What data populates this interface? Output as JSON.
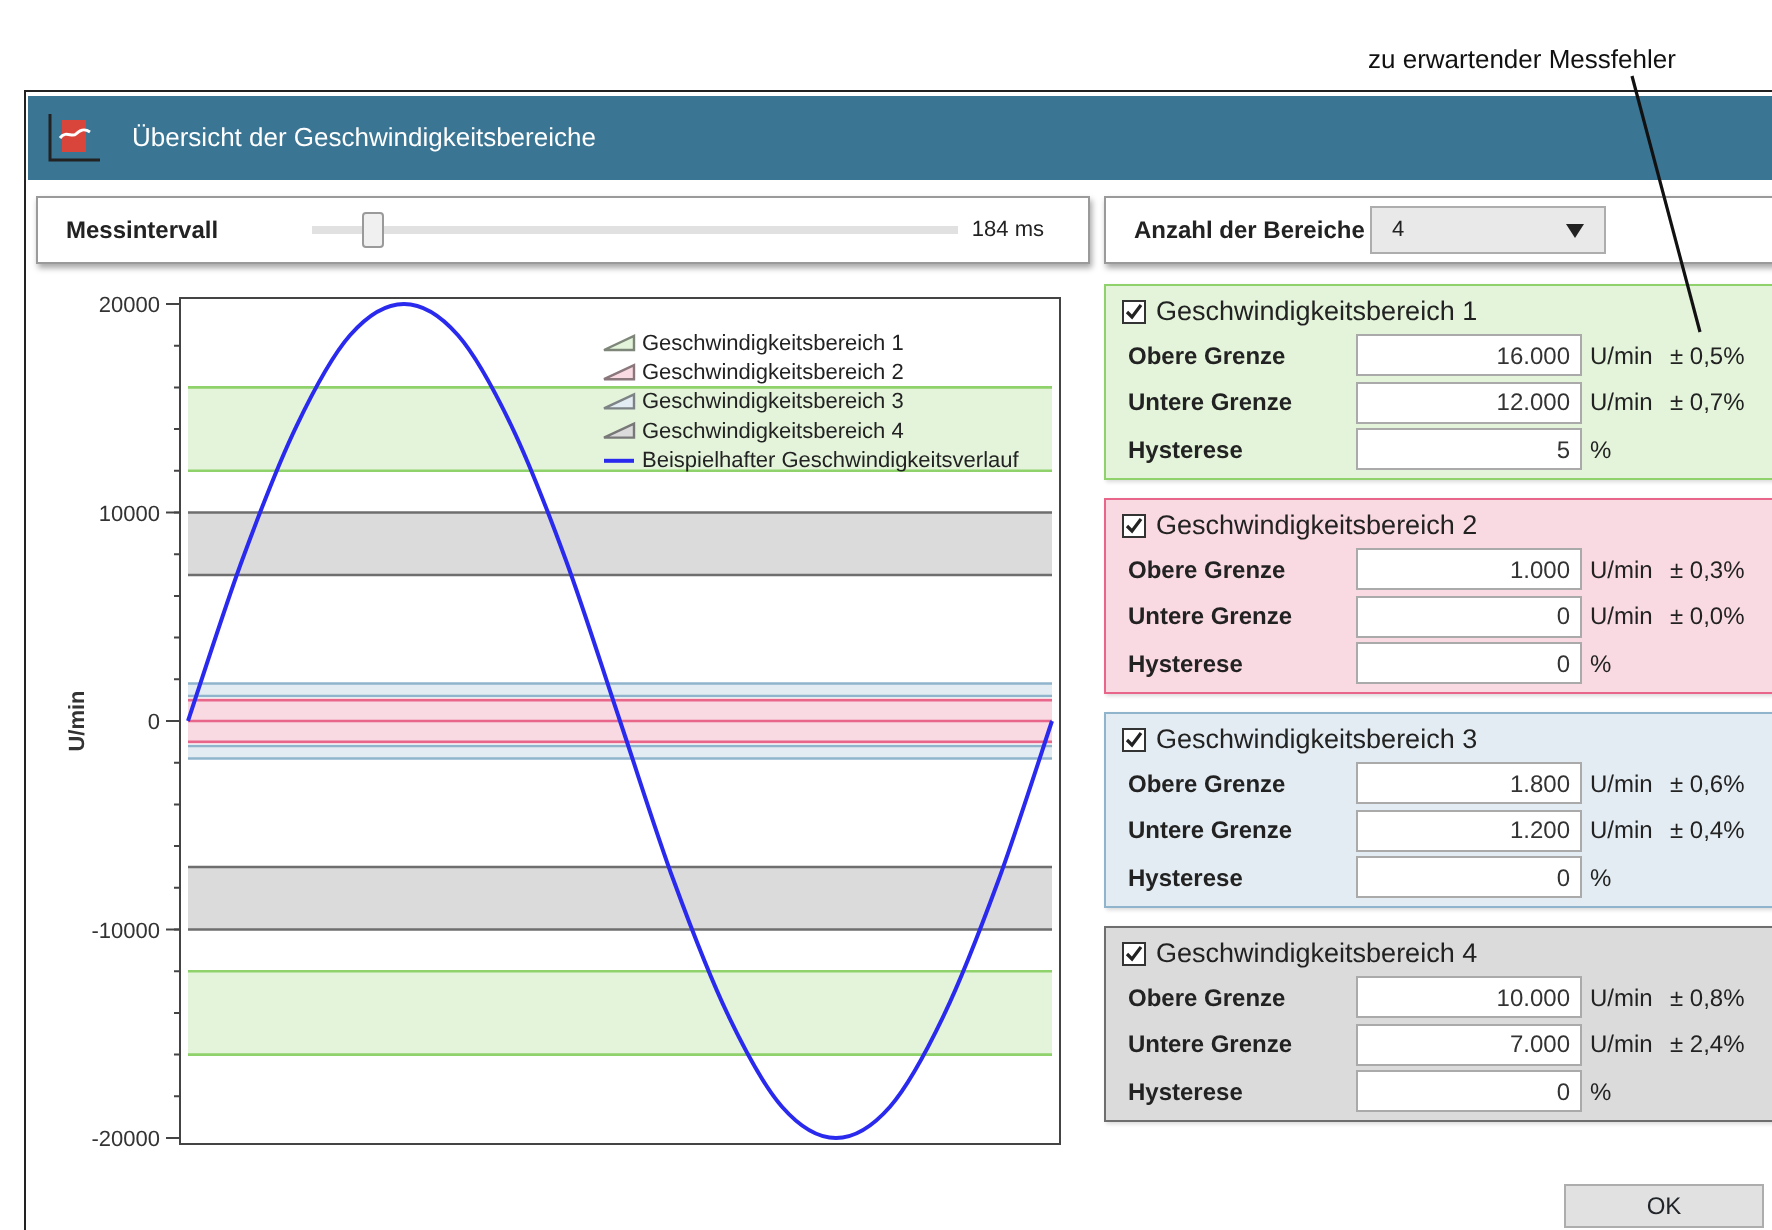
{
  "annotation": "zu erwartender Messfehler",
  "window": {
    "title": "Übersicht der Geschwindigkeitsbereiche"
  },
  "interval": {
    "label": "Messintervall",
    "level": 0.08,
    "reading": "184 ms"
  },
  "range_count": {
    "label": "Anzahl der Bereiche",
    "value": "4"
  },
  "chart": {
    "chart_data": {
      "type": "line",
      "ylabel": "U/min",
      "ylim": [
        -20000,
        20000
      ],
      "yticks": [
        -20000,
        -10000,
        0,
        10000,
        20000
      ],
      "bands": [
        {
          "label": "Geschwindigkeitsbereich 1",
          "axis": "y",
          "color": "#e3f4da",
          "from": 12000,
          "to": 16000
        },
        {
          "label": "Geschwindigkeitsbereich 2",
          "axis": "y",
          "color": "#f9d9e2",
          "from": 0,
          "to": 1000
        },
        {
          "label": "Geschwindigkeitsbereich 3",
          "axis": "y",
          "color": "#e3ecf2",
          "from": 1200,
          "to": 1800
        },
        {
          "label": "Geschwindigkeitsbereich 4",
          "axis": "y",
          "color": "#dbdbdb",
          "from": 7000,
          "to": 10000
        },
        {
          "axis": "y",
          "color": "#e3f4da",
          "from": -16000,
          "to": -12000
        },
        {
          "axis": "y",
          "color": "#f9d9e2",
          "from": -1000,
          "to": 0
        },
        {
          "axis": "y",
          "color": "#e3ecf2",
          "from": -1800,
          "to": -1200
        },
        {
          "axis": "y",
          "color": "#dbdbdb",
          "from": -10000,
          "to": -7000
        }
      ],
      "ref_lines": [
        {
          "axis": "y",
          "value": 16000,
          "color": "#8fd16a"
        },
        {
          "axis": "y",
          "value": 12000,
          "color": "#8fd16a"
        },
        {
          "axis": "y",
          "value": -12000,
          "color": "#8fd16a"
        },
        {
          "axis": "y",
          "value": -16000,
          "color": "#8fd16a"
        },
        {
          "axis": "y",
          "value": 1000,
          "color": "#e8668a"
        },
        {
          "axis": "y",
          "value": 0,
          "color": "#e8668a"
        },
        {
          "axis": "y",
          "value": -1000,
          "color": "#e8668a"
        },
        {
          "axis": "y",
          "value": 1800,
          "color": "#8fb4cc"
        },
        {
          "axis": "y",
          "value": 1200,
          "color": "#8fb4cc"
        },
        {
          "axis": "y",
          "value": -1200,
          "color": "#8fb4cc"
        },
        {
          "axis": "y",
          "value": -1800,
          "color": "#8fb4cc"
        },
        {
          "axis": "y",
          "value": 10000,
          "color": "#6e6e6e"
        },
        {
          "axis": "y",
          "value": 7000,
          "color": "#6e6e6e"
        },
        {
          "axis": "y",
          "value": -7000,
          "color": "#6e6e6e"
        },
        {
          "axis": "y",
          "value": -10000,
          "color": "#6e6e6e"
        }
      ],
      "legend": true,
      "series": [
        {
          "name": "Beispielhafter Geschwindigkeitsverlauf",
          "color": "#2a2aee",
          "values": [
            0,
            7700,
            14100,
            18500,
            20000,
            18500,
            14100,
            7700,
            0,
            -7700,
            -14100,
            -18500,
            -20000,
            -18500,
            -14100,
            -7700,
            0
          ]
        }
      ]
    }
  },
  "ranges": [
    {
      "title": "Geschwindigkeitsbereich 1",
      "checked": true,
      "color": "#8fd16a",
      "fields": [
        {
          "label": "Obere Grenze",
          "value": "16.000",
          "unit": "U/min",
          "error": "± 0,5%"
        },
        {
          "label": "Untere Grenze",
          "value": "12.000",
          "unit": "U/min",
          "error": "± 0,7%"
        },
        {
          "label": "Hysterese",
          "value": "5",
          "unit": "%"
        }
      ]
    },
    {
      "title": "Geschwindigkeitsbereich 2",
      "checked": true,
      "color": "#e8668a",
      "fields": [
        {
          "label": "Obere Grenze",
          "value": "1.000",
          "unit": "U/min",
          "error": "± 0,3%"
        },
        {
          "label": "Untere Grenze",
          "value": "0",
          "unit": "U/min",
          "error": "± 0,0%"
        },
        {
          "label": "Hysterese",
          "value": "0",
          "unit": "%"
        }
      ]
    },
    {
      "title": "Geschwindigkeitsbereich 3",
      "checked": true,
      "color": "#8fb4cc",
      "fields": [
        {
          "label": "Obere Grenze",
          "value": "1.800",
          "unit": "U/min",
          "error": "± 0,6%"
        },
        {
          "label": "Untere Grenze",
          "value": "1.200",
          "unit": "U/min",
          "error": "± 0,4%"
        },
        {
          "label": "Hysterese",
          "value": "0",
          "unit": "%"
        }
      ]
    },
    {
      "title": "Geschwindigkeitsbereich 4",
      "checked": true,
      "color": "#6e6e6e",
      "fields": [
        {
          "label": "Obere Grenze",
          "value": "10.000",
          "unit": "U/min",
          "error": "± 0,8%"
        },
        {
          "label": "Untere Grenze",
          "value": "7.000",
          "unit": "U/min",
          "error": "± 2,4%"
        },
        {
          "label": "Hysterese",
          "value": "0",
          "unit": "%"
        }
      ]
    }
  ],
  "buttons": [
    "OK"
  ]
}
